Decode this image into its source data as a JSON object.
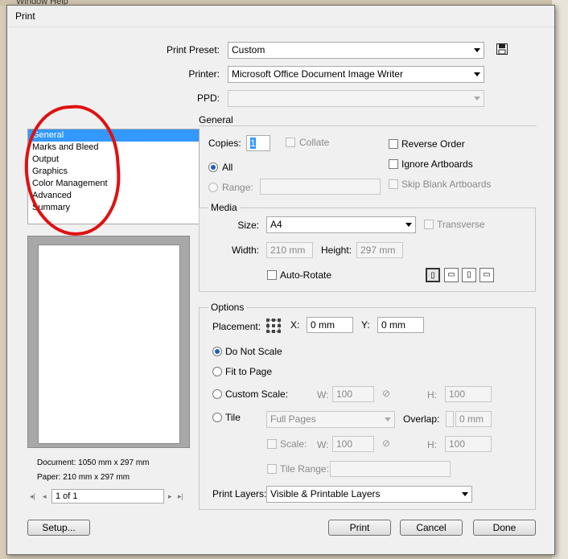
{
  "background": {
    "menu_text": "Window   Help"
  },
  "dialog": {
    "title": "Print",
    "print_preset": {
      "label": "Print Preset:",
      "value": "Custom"
    },
    "printer": {
      "label": "Printer:",
      "value": "Microsoft Office Document Image Writer"
    },
    "ppd": {
      "label": "PPD:",
      "value": ""
    },
    "sidebar": {
      "items": [
        {
          "label": "General",
          "selected": true
        },
        {
          "label": "Marks and Bleed"
        },
        {
          "label": "Output"
        },
        {
          "label": "Graphics"
        },
        {
          "label": "Color Management"
        },
        {
          "label": "Advanced"
        },
        {
          "label": "Summary"
        }
      ]
    },
    "general": {
      "section_title": "General",
      "copies_label": "Copies:",
      "copies_value": "1",
      "collate_label": "Collate",
      "reverse_order_label": "Reverse Order",
      "all_label": "All",
      "ignore_artboards_label": "Ignore Artboards",
      "range_label": "Range:",
      "skip_blank_label": "Skip Blank Artboards"
    },
    "media": {
      "section_title": "Media",
      "size_label": "Size:",
      "size_value": "A4",
      "transverse_label": "Transverse",
      "width_label": "Width:",
      "width_value": "210 mm",
      "height_label": "Height:",
      "height_value": "297 mm",
      "auto_rotate_label": "Auto-Rotate"
    },
    "options": {
      "section_title": "Options",
      "placement_label": "Placement:",
      "x_label": "X:",
      "x_value": "0 mm",
      "y_label": "Y:",
      "y_value": "0 mm",
      "do_not_scale_label": "Do Not Scale",
      "fit_to_page_label": "Fit to Page",
      "custom_scale_label": "Custom Scale:",
      "w_label": "W:",
      "w_value": "100",
      "h_label": "H:",
      "h_value": "100",
      "tile_label": "Tile",
      "tile_value": "Full Pages",
      "overlap_label": "Overlap:",
      "overlap_value": "0 mm",
      "scale_label": "Scale:",
      "scale_w_value": "100",
      "scale_h_value": "100",
      "tile_range_label": "Tile Range:",
      "print_layers_label": "Print Layers:",
      "print_layers_value": "Visible & Printable Layers"
    },
    "preview": {
      "document": "Document: 1050 mm x 297 mm",
      "paper": "Paper: 210 mm x 297 mm",
      "page_indicator": "1 of 1"
    },
    "buttons": {
      "setup": "Setup...",
      "print": "Print",
      "cancel": "Cancel",
      "done": "Done"
    }
  }
}
